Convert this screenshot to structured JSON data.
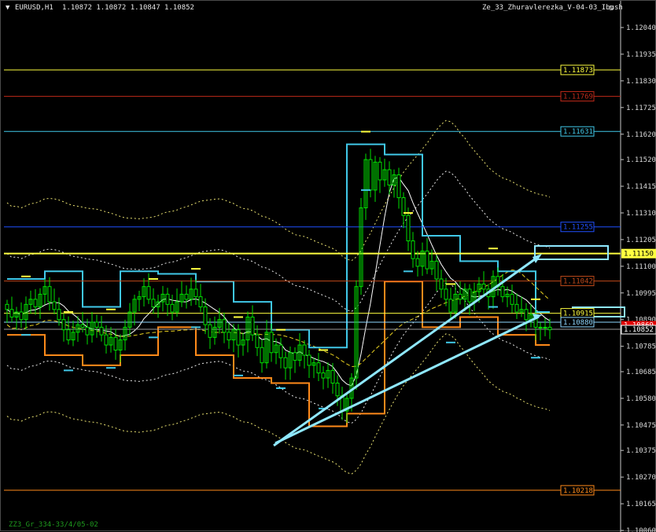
{
  "header": {
    "menu_glyph": "▼",
    "symbol": "EURUSD,H1",
    "ohlc": "1.10872 1.10872 1.10847 1.10852",
    "indicator": "Ze_33_Zhuravlerezka_V-04-03_Ibush",
    "smiley_glyph": "☺"
  },
  "footer": {
    "text": "ZZ3_Gr_334-33/4/05-02"
  },
  "colors": {
    "background": "#000000",
    "candles": "#00e000",
    "yellow": "#ffff40",
    "dark_red": "#c02a1a",
    "cyan": "#40c8e8",
    "blue": "#2050ff",
    "brown": "#c04a1a",
    "light_blue": "#8fd8ff",
    "orange": "#ff8a1a",
    "red_tag": "#e00000"
  },
  "chart_data": {
    "type": "candlestick",
    "symbol": "EURUSD",
    "timeframe": "H1",
    "ylim": [
      1.1006,
      1.1204
    ],
    "y_ticks": [
      "1.12040",
      "1.11935",
      "1.11830",
      "1.11725",
      "1.11620",
      "1.11520",
      "1.11415",
      "1.11310",
      "1.11205",
      "1.11100",
      "1.10995",
      "1.10890",
      "1.10785",
      "1.10685",
      "1.10580",
      "1.10475",
      "1.10375",
      "1.10270",
      "1.10165",
      "1.10060"
    ],
    "levels": [
      {
        "label": "1.11873",
        "value": 1.11873,
        "color": "yellow"
      },
      {
        "label": "1.11769",
        "value": 1.11769,
        "color": "dark_red"
      },
      {
        "label": "1.11631",
        "value": 1.11631,
        "color": "cyan"
      },
      {
        "label": "1.11255",
        "value": 1.11255,
        "color": "blue"
      },
      {
        "label": "1.11150",
        "value": 1.1115,
        "color": "yellow",
        "highlight": true
      },
      {
        "label": "1.11042",
        "value": 1.11042,
        "color": "brown"
      },
      {
        "label": "1.10915",
        "value": 1.10915,
        "color": "yellow"
      },
      {
        "label": "1.10880",
        "value": 1.1088,
        "color": "light_blue"
      },
      {
        "label": "1.10218",
        "value": 1.10218,
        "color": "orange"
      }
    ],
    "bid_label": "1.10852",
    "bid_value": 1.10852,
    "hidden_tag_label": "1.10869",
    "hidden_tag_value": 1.10869,
    "closes": [
      1.1093,
      1.109,
      1.1092,
      1.1089,
      1.1095,
      1.1097,
      1.1094,
      1.1099,
      1.1102,
      1.1096,
      1.1093,
      1.1089,
      1.1085,
      1.1081,
      1.1084,
      1.1087,
      1.1086,
      1.1083,
      1.1088,
      1.1086,
      1.1083,
      1.1079,
      1.1082,
      1.1077,
      1.1081,
      1.1086,
      1.1092,
      1.1097,
      1.1098,
      1.1102,
      1.1097,
      1.1094,
      1.1096,
      1.1099,
      1.1095,
      1.1092,
      1.1096,
      1.1099,
      1.1097,
      1.1101,
      1.1098,
      1.1094,
      1.1087,
      1.1082,
      1.1086,
      1.1089,
      1.1084,
      1.1081,
      1.1085,
      1.1079,
      1.1081,
      1.109,
      1.1083,
      1.1078,
      1.1072,
      1.1084,
      1.1076,
      1.1079,
      1.1074,
      1.107,
      1.1076,
      1.1073,
      1.1079,
      1.1075,
      1.1071,
      1.1072,
      1.1068,
      1.1066,
      1.1069,
      1.1064,
      1.1059,
      1.1053,
      1.1058,
      1.1066,
      1.1102,
      1.1133,
      1.1152,
      1.114,
      1.1151,
      1.1144,
      1.1148,
      1.1142,
      1.1146,
      1.1137,
      1.113,
      1.112,
      1.1113,
      1.111,
      1.1116,
      1.1109,
      1.1112,
      1.1105,
      1.1101,
      1.1097,
      1.1092,
      1.1099,
      1.1097,
      1.1101,
      1.1096,
      1.11,
      1.1103,
      1.1101,
      1.1098,
      1.1106,
      1.1102,
      1.1098,
      1.1099,
      1.1095,
      1.1092,
      1.1093,
      1.1089,
      1.1091,
      1.1086,
      1.1086,
      1.1086,
      1.1085
    ]
  }
}
